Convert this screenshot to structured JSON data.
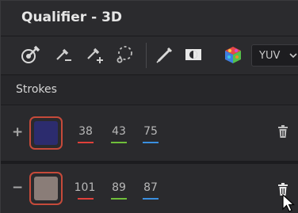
{
  "panel": {
    "title": "Qualifier - 3D"
  },
  "toolbar": {
    "tools": [
      {
        "icon": "eyedropper-target-icon"
      },
      {
        "icon": "eyedropper-minus-icon"
      },
      {
        "icon": "eyedropper-plus-icon"
      },
      {
        "icon": "lasso-icon"
      },
      {
        "icon": "pen-icon"
      },
      {
        "icon": "invert-icon"
      },
      {
        "icon": "color-cube-icon"
      }
    ],
    "colorspace": "YUV"
  },
  "strokes": {
    "label": "Strokes",
    "rows": [
      {
        "sign": "+",
        "swatch_color": "#2c2c6e",
        "values": [
          "38",
          "43",
          "75"
        ],
        "underline_colors": [
          "#e0403a",
          "#6fbf3a",
          "#3a8fe0"
        ]
      },
      {
        "sign": "−",
        "swatch_color": "#8a7d78",
        "values": [
          "101",
          "89",
          "87"
        ],
        "underline_colors": [
          "#e0403a",
          "#6fbf3a",
          "#3a8fe0"
        ]
      }
    ]
  },
  "colors": {
    "accent_border": "#c64a3a"
  }
}
